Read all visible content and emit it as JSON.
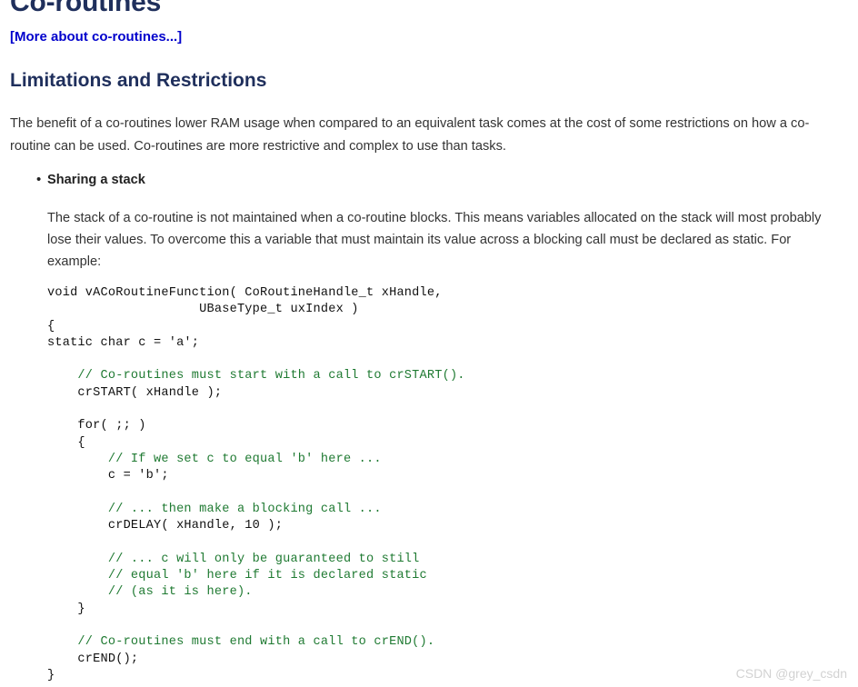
{
  "page": {
    "title": "Co-routines",
    "background_color": "#ffffff",
    "heading_color": "#1f2f5c",
    "link_color": "#0000cc",
    "body_text_color": "#333333",
    "code_text_color": "#111111",
    "comment_color": "#1f7a32",
    "watermark_color": "#d2d2d2"
  },
  "more_link": {
    "label": "[More about co-routines...]"
  },
  "section": {
    "heading": "Limitations and Restrictions",
    "intro": "The benefit of a co-routines lower RAM usage when compared to an equivalent task comes at the cost of some restrictions on how a co-routine can be used. Co-routines are more restrictive and complex to use than tasks."
  },
  "bullets": [
    {
      "marker": "•",
      "label": "Sharing a stack",
      "body": "The stack of a co-routine is not maintained when a co-routine blocks. This means variables allocated on the stack will most probably lose their values. To overcome this a variable that must maintain its value across a blocking call must be declared as static. For example:"
    }
  ],
  "code": {
    "language": "c",
    "lines": [
      {
        "text": "void vACoRoutineFunction( CoRoutineHandle_t xHandle,",
        "kind": "code"
      },
      {
        "text": "                    UBaseType_t uxIndex )",
        "kind": "code"
      },
      {
        "text": "{",
        "kind": "code"
      },
      {
        "text": "static char c = 'a';",
        "kind": "code"
      },
      {
        "text": "",
        "kind": "code"
      },
      {
        "text": "    // Co-routines must start with a call to crSTART().",
        "kind": "comment"
      },
      {
        "text": "    crSTART( xHandle );",
        "kind": "code"
      },
      {
        "text": "",
        "kind": "code"
      },
      {
        "text": "    for( ;; )",
        "kind": "code"
      },
      {
        "text": "    {",
        "kind": "code"
      },
      {
        "text": "        // If we set c to equal 'b' here ...",
        "kind": "comment"
      },
      {
        "text": "        c = 'b';",
        "kind": "code"
      },
      {
        "text": "",
        "kind": "code"
      },
      {
        "text": "        // ... then make a blocking call ...",
        "kind": "comment"
      },
      {
        "text": "        crDELAY( xHandle, 10 );",
        "kind": "code"
      },
      {
        "text": "",
        "kind": "code"
      },
      {
        "text": "        // ... c will only be guaranteed to still",
        "kind": "comment"
      },
      {
        "text": "        // equal 'b' here if it is declared static",
        "kind": "comment"
      },
      {
        "text": "        // (as it is here).",
        "kind": "comment"
      },
      {
        "text": "    }",
        "kind": "code"
      },
      {
        "text": "",
        "kind": "code"
      },
      {
        "text": "    // Co-routines must end with a call to crEND().",
        "kind": "comment"
      },
      {
        "text": "    crEND();",
        "kind": "code"
      },
      {
        "text": "}",
        "kind": "code"
      }
    ]
  },
  "watermark": {
    "text": "CSDN @grey_csdn"
  }
}
